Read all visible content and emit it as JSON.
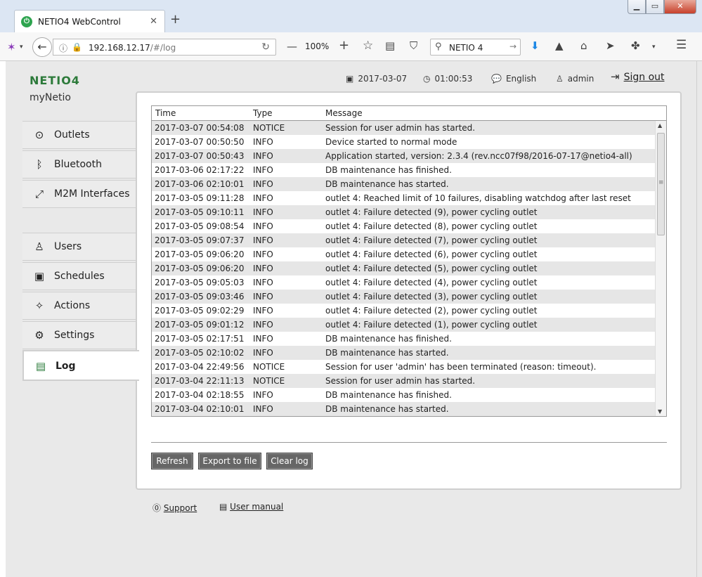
{
  "browser": {
    "tab_title": "NETIO4 WebControl",
    "url_host": "192.168.12.17",
    "url_path": "/#/log",
    "zoom": "100%",
    "search_text": "NETIO 4"
  },
  "header": {
    "logo": "NETIO4",
    "device_name": "myNetio",
    "date": "2017-03-07",
    "time": "01:00:53",
    "language": "English",
    "user": "admin",
    "signout": "Sign out"
  },
  "sidebar": {
    "items": [
      {
        "label": "Outlets",
        "icon": "outlet-icon"
      },
      {
        "label": "Bluetooth",
        "icon": "bluetooth-icon"
      },
      {
        "label": "M2M Interfaces",
        "icon": "m2m-icon"
      },
      {
        "label": "Users",
        "icon": "user-icon"
      },
      {
        "label": "Schedules",
        "icon": "schedule-icon"
      },
      {
        "label": "Actions",
        "icon": "wand-icon"
      },
      {
        "label": "Settings",
        "icon": "gear-icon"
      },
      {
        "label": "Log",
        "icon": "document-icon"
      }
    ],
    "active": "Log"
  },
  "log": {
    "columns": [
      "Time",
      "Type",
      "Message"
    ],
    "rows": [
      [
        "2017-03-07 00:54:08",
        "NOTICE",
        "Session for user admin has started."
      ],
      [
        "2017-03-07 00:50:50",
        "INFO",
        "Device started to normal mode"
      ],
      [
        "2017-03-07 00:50:43",
        "INFO",
        "Application started, version: 2.3.4 (rev.ncc07f98/2016-07-17@netio4-all)"
      ],
      [
        "2017-03-06 02:17:22",
        "INFO",
        "DB maintenance has finished."
      ],
      [
        "2017-03-06 02:10:01",
        "INFO",
        "DB maintenance has started."
      ],
      [
        "2017-03-05 09:11:28",
        "INFO",
        "outlet 4: Reached limit of 10 failures, disabling watchdog after last reset"
      ],
      [
        "2017-03-05 09:10:11",
        "INFO",
        "outlet 4: Failure detected (9), power cycling outlet"
      ],
      [
        "2017-03-05 09:08:54",
        "INFO",
        "outlet 4: Failure detected (8), power cycling outlet"
      ],
      [
        "2017-03-05 09:07:37",
        "INFO",
        "outlet 4: Failure detected (7), power cycling outlet"
      ],
      [
        "2017-03-05 09:06:20",
        "INFO",
        "outlet 4: Failure detected (6), power cycling outlet"
      ],
      [
        "2017-03-05 09:06:20",
        "INFO",
        "outlet 4: Failure detected (5), power cycling outlet"
      ],
      [
        "2017-03-05 09:05:03",
        "INFO",
        "outlet 4: Failure detected (4), power cycling outlet"
      ],
      [
        "2017-03-05 09:03:46",
        "INFO",
        "outlet 4: Failure detected (3), power cycling outlet"
      ],
      [
        "2017-03-05 09:02:29",
        "INFO",
        "outlet 4: Failure detected (2), power cycling outlet"
      ],
      [
        "2017-03-05 09:01:12",
        "INFO",
        "outlet 4: Failure detected (1), power cycling outlet"
      ],
      [
        "2017-03-05 02:17:51",
        "INFO",
        "DB maintenance has finished."
      ],
      [
        "2017-03-05 02:10:02",
        "INFO",
        "DB maintenance has started."
      ],
      [
        "2017-03-04 22:49:56",
        "NOTICE",
        "Session for user 'admin' has been terminated (reason: timeout)."
      ],
      [
        "2017-03-04 22:11:13",
        "NOTICE",
        "Session for user admin has started."
      ],
      [
        "2017-03-04 02:18:55",
        "INFO",
        "DB maintenance has finished."
      ],
      [
        "2017-03-04 02:10:01",
        "INFO",
        "DB maintenance has started."
      ]
    ]
  },
  "buttons": {
    "refresh": "Refresh",
    "export": "Export to file",
    "clear": "Clear log"
  },
  "footer": {
    "support": "Support",
    "manual": "User manual"
  },
  "colors": {
    "accent": "#2c7a3a",
    "panel_border": "#cfcfcf",
    "button_bg": "#666666"
  }
}
